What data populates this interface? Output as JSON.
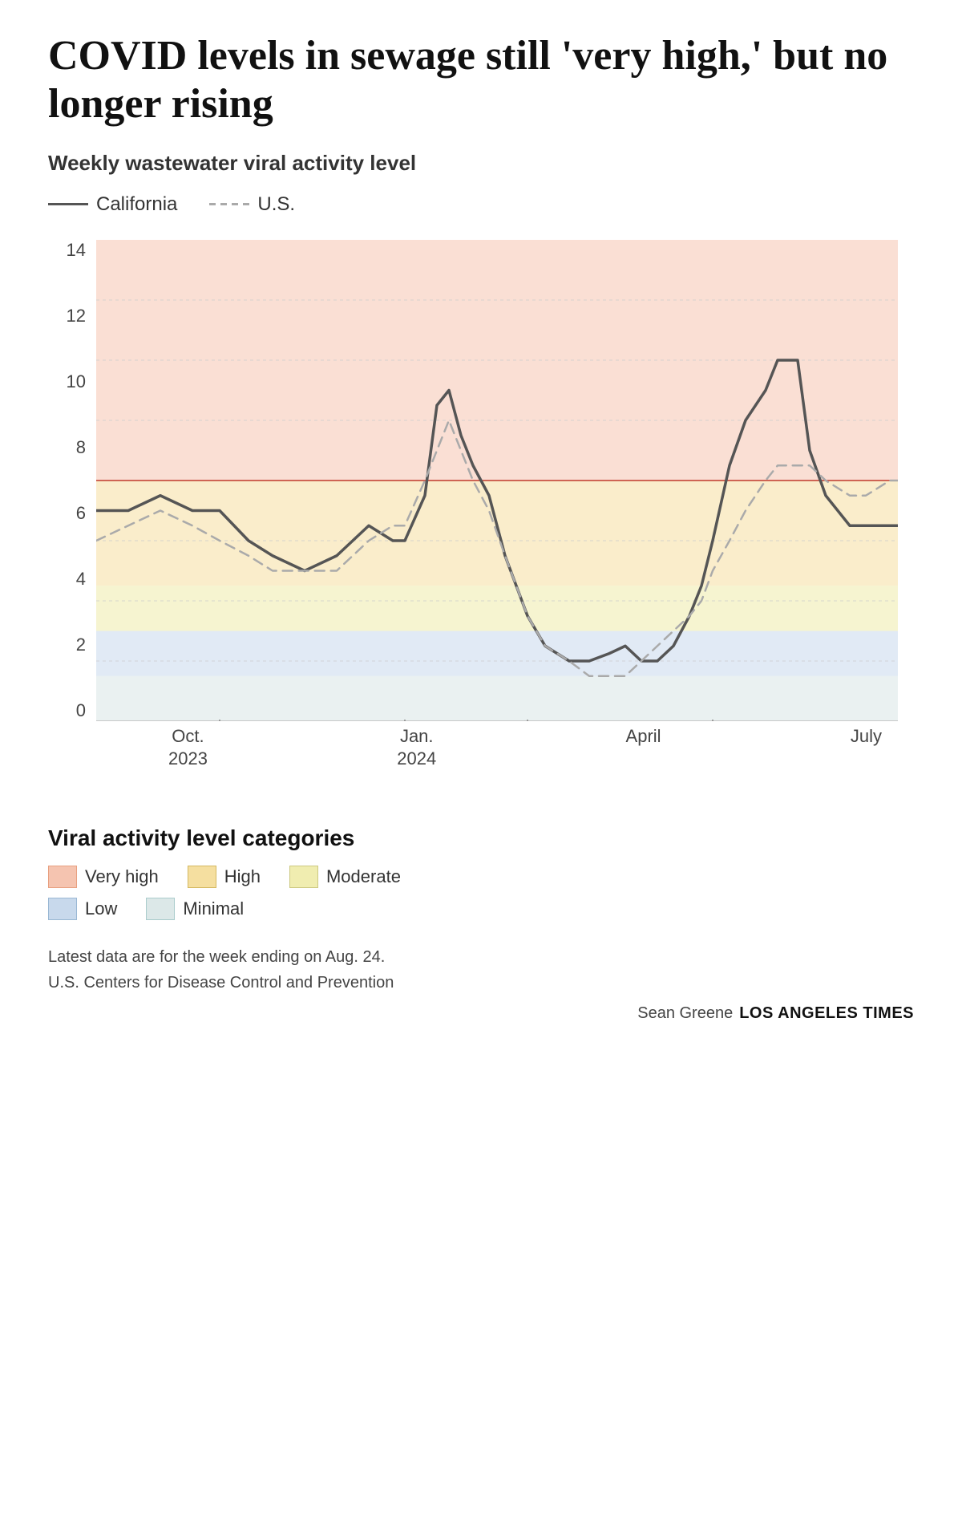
{
  "title": "COVID levels in sewage still 'very high,' but no longer rising",
  "chart": {
    "subtitle": "Weekly wastewater viral activity level",
    "legend": {
      "california_label": "California",
      "us_label": "U.S."
    },
    "y_axis": {
      "labels": [
        "0",
        "2",
        "4",
        "6",
        "8",
        "10",
        "12",
        "14"
      ]
    },
    "x_axis": {
      "labels": [
        {
          "line1": "Oct.",
          "line2": "2023"
        },
        {
          "line1": "Jan.",
          "line2": "2024"
        },
        {
          "line1": "April",
          "line2": ""
        },
        {
          "line1": "July",
          "line2": ""
        }
      ]
    },
    "zones": {
      "very_high_threshold": 8,
      "high_threshold": 4.5,
      "moderate_threshold": 3,
      "low_threshold": 2,
      "minimal_threshold": 1.5
    }
  },
  "categories": {
    "title": "Viral activity level categories",
    "items": [
      {
        "label": "Very high",
        "color": "#f5c4b0"
      },
      {
        "label": "High",
        "color": "#f5dfa0"
      },
      {
        "label": "Moderate",
        "color": "#f0edb0"
      },
      {
        "label": "Low",
        "color": "#c8d9ec"
      },
      {
        "label": "Minimal",
        "color": "#dce8e8"
      }
    ]
  },
  "footer": {
    "note1": "Latest data are for the week ending on Aug. 24.",
    "note2": "U.S. Centers for Disease Control and Prevention",
    "credit_name": "Sean Greene",
    "credit_pub": "LOS ANGELES TIMES"
  }
}
